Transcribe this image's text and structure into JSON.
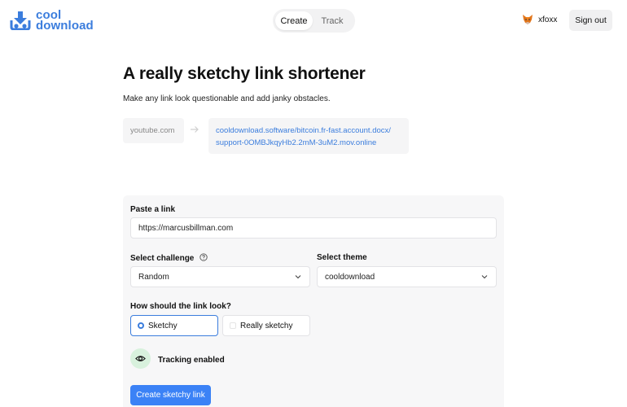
{
  "header": {
    "logo_line1": "cool",
    "logo_line2": "download",
    "tabs": [
      {
        "label": "Create",
        "active": true
      },
      {
        "label": "Track",
        "active": false
      }
    ],
    "username": "xfoxx",
    "signout_label": "Sign out"
  },
  "hero": {
    "title": "A really sketchy link shortener",
    "subtitle": "Make any link look questionable and add janky obstacles.",
    "example_short": "youtube.com",
    "example_long_line1": "cooldownload.software/bitcoin.fr-fast.account.docx/",
    "example_long_line2": "support-0OMBJkqyHb2.2mM-3uM2.mov.online"
  },
  "form": {
    "link_label": "Paste a link",
    "link_value": "https://marcusbillman.com",
    "challenge_label": "Select challenge",
    "challenge_value": "Random",
    "theme_label": "Select theme",
    "theme_value": "cooldownload",
    "look_label": "How should the link look?",
    "look_options": [
      {
        "label": "Sketchy",
        "selected": true
      },
      {
        "label": "Really sketchy",
        "selected": false
      }
    ],
    "tracking_label": "Tracking enabled",
    "create_label": "Create sketchy link"
  },
  "colors": {
    "accent": "#3b7ddd",
    "button": "#3b82f6",
    "tracking_bg": "#d8f1dd"
  },
  "icons": {
    "logo": "download-tray-icon",
    "user": "fox-icon",
    "arrow": "arrow-right-icon",
    "help": "help-circle-icon",
    "chevron": "chevron-down-icon",
    "tracking": "eye-icon"
  }
}
